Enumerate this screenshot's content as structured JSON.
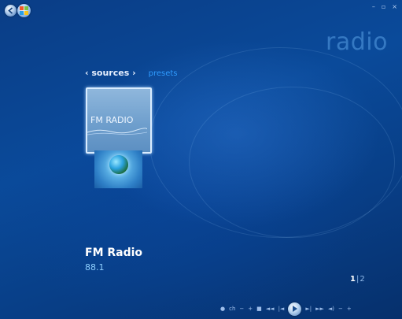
{
  "app": {
    "title": "radio"
  },
  "window_controls": {
    "minimize": "–",
    "restore": "▫",
    "close": "×"
  },
  "nav": {
    "sources_label": "‹ sources ›",
    "presets_label": "presets"
  },
  "tile": {
    "label": "FM RADIO"
  },
  "station": {
    "name": "FM Radio",
    "frequency": "88.1"
  },
  "pager": {
    "current": "1",
    "separator": "|",
    "total": "2"
  },
  "transport": {
    "record": "●",
    "ch_label": "ch",
    "ch_down": "−",
    "ch_up": "+",
    "stop": "■",
    "rewind": "◄◄",
    "prev": "|◄",
    "next": "►|",
    "fast_forward": "►►",
    "volume": "◄)",
    "vol_down": "−",
    "vol_up": "+"
  },
  "colors": {
    "accent": "#2f9bff",
    "background": "#0a4a9a",
    "frequency_text": "#8fd0ff"
  },
  "icons": [
    "back-arrow-icon",
    "media-center-logo-icon",
    "globe-icon",
    "play-icon"
  ]
}
